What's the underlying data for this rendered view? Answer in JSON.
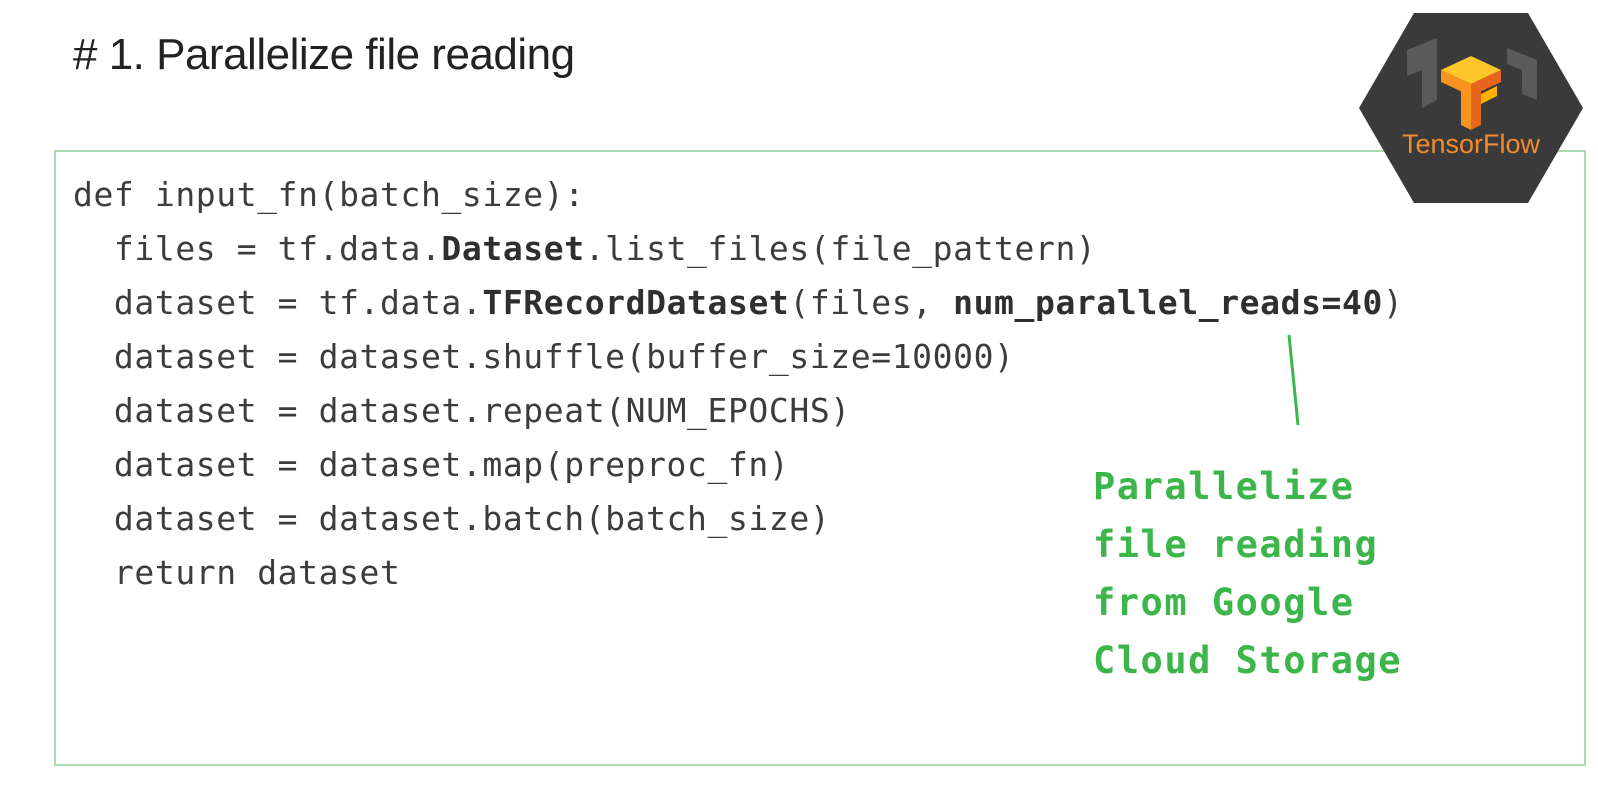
{
  "slide": {
    "title": "# 1. Parallelize file reading"
  },
  "code_lines": [
    [
      {
        "t": "def input_fn(batch_size):"
      }
    ],
    [
      {
        "t": "  files = tf.data."
      },
      {
        "t": "Dataset",
        "b": true
      },
      {
        "t": ".list_files(file_pattern)"
      }
    ],
    [
      {
        "t": "  dataset = tf.data."
      },
      {
        "t": "TFRecordDataset",
        "b": true
      },
      {
        "t": "(files, "
      },
      {
        "t": "num_parallel_reads=40",
        "b": true
      },
      {
        "t": ")"
      }
    ],
    [
      {
        "t": "  dataset = dataset.shuffle(buffer_size=10000)"
      }
    ],
    [
      {
        "t": "  dataset = dataset.repeat(NUM_EPOCHS)"
      }
    ],
    [
      {
        "t": "  dataset = dataset.map(preproc_fn)"
      }
    ],
    [
      {
        "t": "  dataset = dataset.batch(batch_size)"
      }
    ],
    [
      {
        "t": "  return dataset"
      }
    ]
  ],
  "annotation": {
    "lines": [
      "Parallelize",
      "file reading",
      "from Google",
      "Cloud Storage"
    ],
    "color": "#3cb54a"
  },
  "logo": {
    "label": "TensorFlow",
    "icon": "tensorflow-logo-icon",
    "background": "#3a3a3a",
    "accent": "#f7931e"
  },
  "colors": {
    "code_border": "#a8dcb0",
    "code_text": "#3c3c3c"
  }
}
